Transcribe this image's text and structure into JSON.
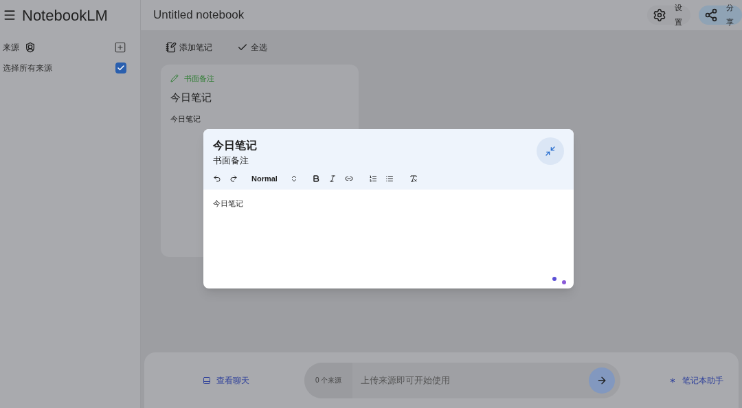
{
  "app": {
    "title": "NotebookLM"
  },
  "sidebar": {
    "heading": "来源",
    "select_all": {
      "label": "选择所有来源",
      "checked": true
    }
  },
  "header": {
    "title": "Untitled notebook",
    "buttons": [
      {
        "label": "设置",
        "kind": "settings"
      },
      {
        "label": "分享",
        "kind": "share"
      }
    ]
  },
  "toolbar": [
    {
      "label": "添加笔记",
      "kind": "note"
    },
    {
      "label": "全选",
      "kind": "check"
    }
  ],
  "note_card": {
    "tag": "书面备注",
    "title": "今日笔记",
    "body": "今日笔记"
  },
  "editor": {
    "title": "今日笔记",
    "subtitle": "书面备注",
    "format": "Normal",
    "body": "今日笔记"
  },
  "bottom": {
    "chat_button": "查看聊天",
    "source_count": "0 个来源",
    "placeholder": "上传来源即可开始使用",
    "assistant_button": "笔记本助手"
  }
}
